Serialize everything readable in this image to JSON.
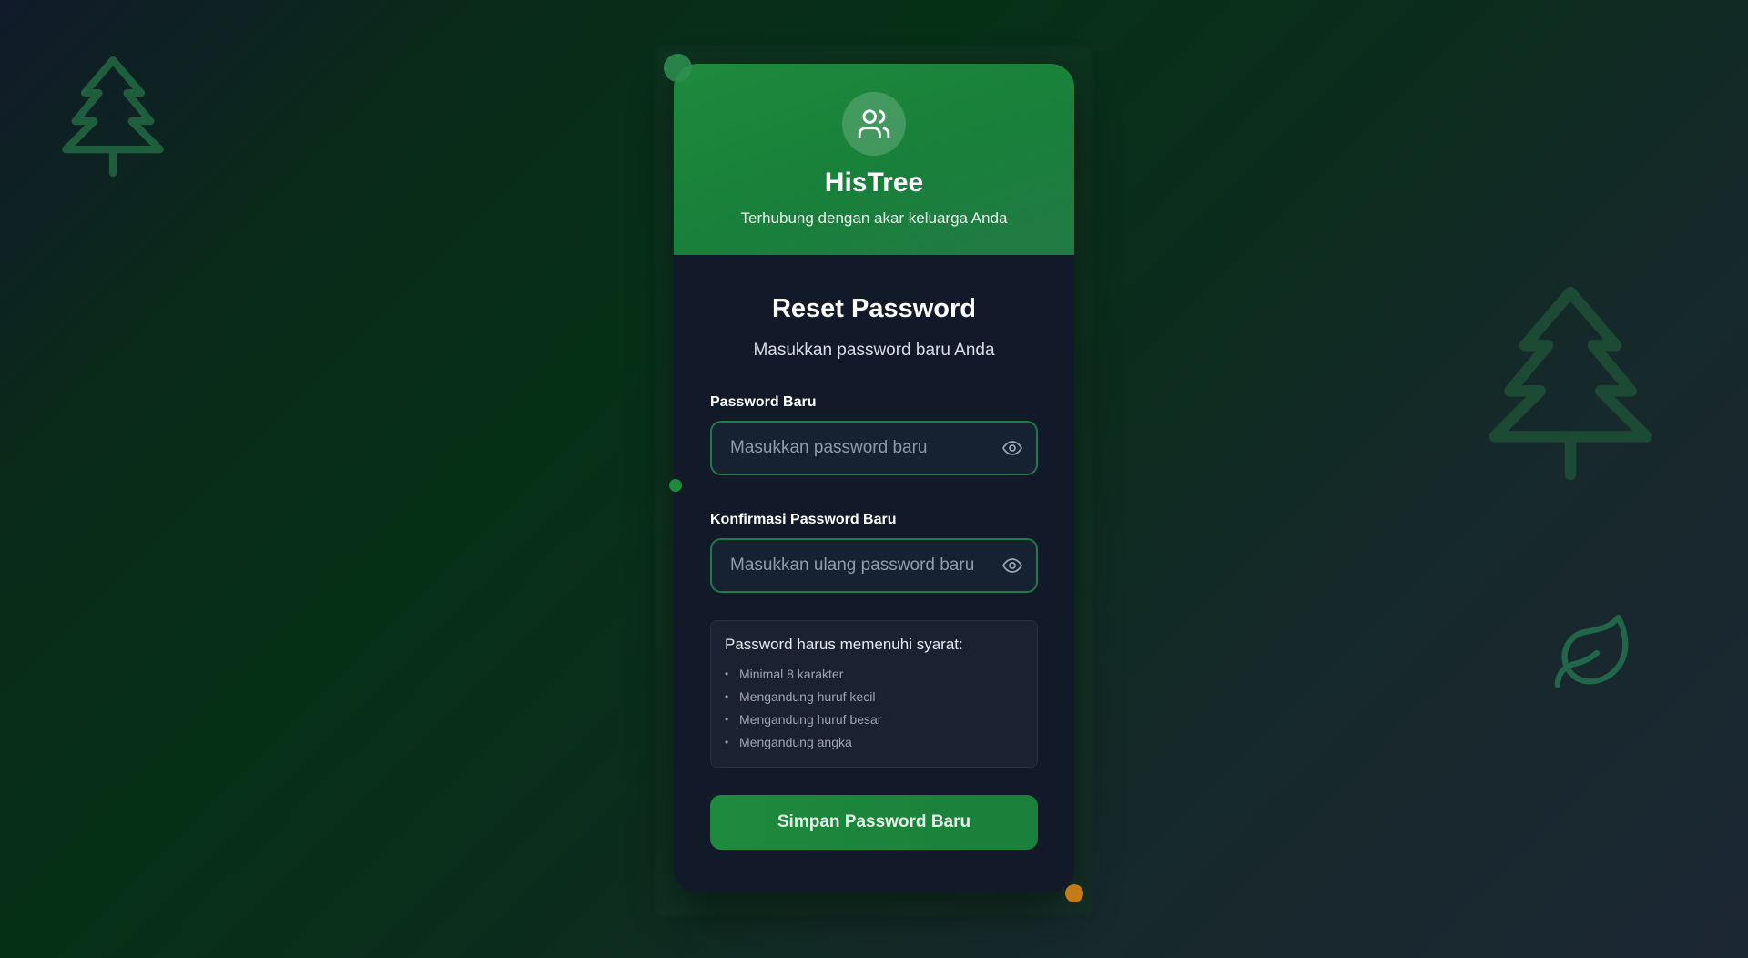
{
  "brand": {
    "name": "HisTree",
    "tagline": "Terhubung dengan akar keluarga Anda",
    "logo_icon": "users-icon",
    "primary_color": "#1e8a3d",
    "accent_color": "#c47a16"
  },
  "form": {
    "title": "Reset Password",
    "subtitle": "Masukkan password baru Anda",
    "new_password": {
      "label": "Password Baru",
      "placeholder": "Masukkan password baru",
      "value": "",
      "toggle_icon": "eye-icon"
    },
    "confirm_password": {
      "label": "Konfirmasi Password Baru",
      "placeholder": "Masukkan ulang password baru",
      "value": "",
      "toggle_icon": "eye-icon"
    },
    "requirements": {
      "title": "Password harus memenuhi syarat:",
      "items": [
        "Minimal 8 karakter",
        "Mengandung huruf kecil",
        "Mengandung huruf besar",
        "Mengandung angka"
      ]
    },
    "submit_label": "Simpan Password Baru"
  },
  "decorations": {
    "icons": [
      "tree-icon",
      "tree-icon",
      "leaf-icon"
    ]
  }
}
